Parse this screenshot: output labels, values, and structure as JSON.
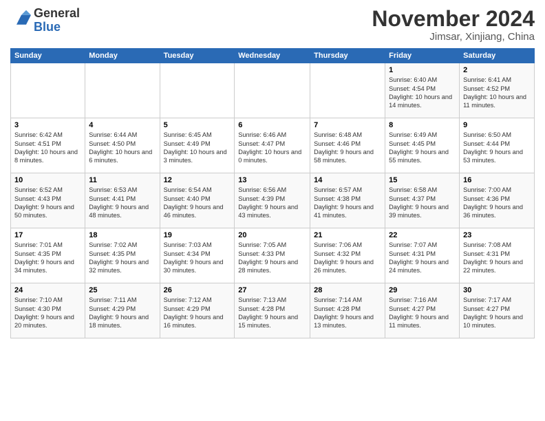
{
  "logo": {
    "general": "General",
    "blue": "Blue"
  },
  "header": {
    "month": "November 2024",
    "location": "Jimsar, Xinjiang, China"
  },
  "weekdays": [
    "Sunday",
    "Monday",
    "Tuesday",
    "Wednesday",
    "Thursday",
    "Friday",
    "Saturday"
  ],
  "weeks": [
    [
      {
        "day": "",
        "info": ""
      },
      {
        "day": "",
        "info": ""
      },
      {
        "day": "",
        "info": ""
      },
      {
        "day": "",
        "info": ""
      },
      {
        "day": "",
        "info": ""
      },
      {
        "day": "1",
        "info": "Sunrise: 6:40 AM\nSunset: 4:54 PM\nDaylight: 10 hours and 14 minutes."
      },
      {
        "day": "2",
        "info": "Sunrise: 6:41 AM\nSunset: 4:52 PM\nDaylight: 10 hours and 11 minutes."
      }
    ],
    [
      {
        "day": "3",
        "info": "Sunrise: 6:42 AM\nSunset: 4:51 PM\nDaylight: 10 hours and 8 minutes."
      },
      {
        "day": "4",
        "info": "Sunrise: 6:44 AM\nSunset: 4:50 PM\nDaylight: 10 hours and 6 minutes."
      },
      {
        "day": "5",
        "info": "Sunrise: 6:45 AM\nSunset: 4:49 PM\nDaylight: 10 hours and 3 minutes."
      },
      {
        "day": "6",
        "info": "Sunrise: 6:46 AM\nSunset: 4:47 PM\nDaylight: 10 hours and 0 minutes."
      },
      {
        "day": "7",
        "info": "Sunrise: 6:48 AM\nSunset: 4:46 PM\nDaylight: 9 hours and 58 minutes."
      },
      {
        "day": "8",
        "info": "Sunrise: 6:49 AM\nSunset: 4:45 PM\nDaylight: 9 hours and 55 minutes."
      },
      {
        "day": "9",
        "info": "Sunrise: 6:50 AM\nSunset: 4:44 PM\nDaylight: 9 hours and 53 minutes."
      }
    ],
    [
      {
        "day": "10",
        "info": "Sunrise: 6:52 AM\nSunset: 4:43 PM\nDaylight: 9 hours and 50 minutes."
      },
      {
        "day": "11",
        "info": "Sunrise: 6:53 AM\nSunset: 4:41 PM\nDaylight: 9 hours and 48 minutes."
      },
      {
        "day": "12",
        "info": "Sunrise: 6:54 AM\nSunset: 4:40 PM\nDaylight: 9 hours and 46 minutes."
      },
      {
        "day": "13",
        "info": "Sunrise: 6:56 AM\nSunset: 4:39 PM\nDaylight: 9 hours and 43 minutes."
      },
      {
        "day": "14",
        "info": "Sunrise: 6:57 AM\nSunset: 4:38 PM\nDaylight: 9 hours and 41 minutes."
      },
      {
        "day": "15",
        "info": "Sunrise: 6:58 AM\nSunset: 4:37 PM\nDaylight: 9 hours and 39 minutes."
      },
      {
        "day": "16",
        "info": "Sunrise: 7:00 AM\nSunset: 4:36 PM\nDaylight: 9 hours and 36 minutes."
      }
    ],
    [
      {
        "day": "17",
        "info": "Sunrise: 7:01 AM\nSunset: 4:35 PM\nDaylight: 9 hours and 34 minutes."
      },
      {
        "day": "18",
        "info": "Sunrise: 7:02 AM\nSunset: 4:35 PM\nDaylight: 9 hours and 32 minutes."
      },
      {
        "day": "19",
        "info": "Sunrise: 7:03 AM\nSunset: 4:34 PM\nDaylight: 9 hours and 30 minutes."
      },
      {
        "day": "20",
        "info": "Sunrise: 7:05 AM\nSunset: 4:33 PM\nDaylight: 9 hours and 28 minutes."
      },
      {
        "day": "21",
        "info": "Sunrise: 7:06 AM\nSunset: 4:32 PM\nDaylight: 9 hours and 26 minutes."
      },
      {
        "day": "22",
        "info": "Sunrise: 7:07 AM\nSunset: 4:31 PM\nDaylight: 9 hours and 24 minutes."
      },
      {
        "day": "23",
        "info": "Sunrise: 7:08 AM\nSunset: 4:31 PM\nDaylight: 9 hours and 22 minutes."
      }
    ],
    [
      {
        "day": "24",
        "info": "Sunrise: 7:10 AM\nSunset: 4:30 PM\nDaylight: 9 hours and 20 minutes."
      },
      {
        "day": "25",
        "info": "Sunrise: 7:11 AM\nSunset: 4:29 PM\nDaylight: 9 hours and 18 minutes."
      },
      {
        "day": "26",
        "info": "Sunrise: 7:12 AM\nSunset: 4:29 PM\nDaylight: 9 hours and 16 minutes."
      },
      {
        "day": "27",
        "info": "Sunrise: 7:13 AM\nSunset: 4:28 PM\nDaylight: 9 hours and 15 minutes."
      },
      {
        "day": "28",
        "info": "Sunrise: 7:14 AM\nSunset: 4:28 PM\nDaylight: 9 hours and 13 minutes."
      },
      {
        "day": "29",
        "info": "Sunrise: 7:16 AM\nSunset: 4:27 PM\nDaylight: 9 hours and 11 minutes."
      },
      {
        "day": "30",
        "info": "Sunrise: 7:17 AM\nSunset: 4:27 PM\nDaylight: 9 hours and 10 minutes."
      }
    ]
  ]
}
